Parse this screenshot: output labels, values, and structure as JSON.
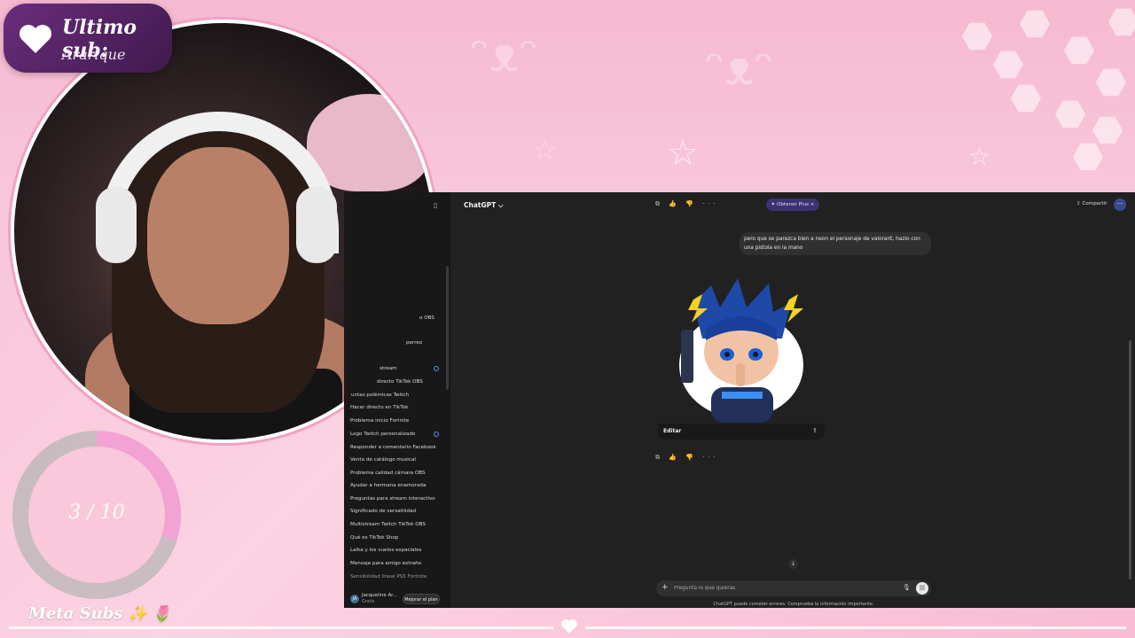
{
  "overlay": {
    "last_sub_title": "Ultimo sub:",
    "last_sub_name": "Ararique",
    "goal_progress_text": "3 / 10",
    "goal_progress_fraction": 0.3,
    "goal_label": "Meta Subs",
    "goal_emoji": "✨ 🌷",
    "colors": {
      "badge": "#5a2670",
      "pink": "#f7c1d6",
      "ring_fill": "#f2a2d3"
    }
  },
  "chatgpt": {
    "title": "ChatGPT ⌵",
    "plus_button": "✦ Obtener Plus ×",
    "share": "⇪ Compartir",
    "more": "···",
    "top_actions": "⧉ 👍 👎 ···",
    "user_message": "pero que se parezca bien a neon el personaje de valorant, hazlo con una pistola en la mano",
    "edit": "Editar",
    "image_actions": "⧉ 👍 👎 ···",
    "composer_placeholder": "Pregunta lo que quieras",
    "disclaimer": "ChatGPT puede cometer errores. Comprueba la información importante.",
    "user_name": "Jacqueline Ar...",
    "user_plan": "Gratis",
    "upgrade": "Mejorar el plan",
    "sidebar_items": [
      "o OBS",
      "perreo",
      "stream",
      "directo TikTok OBS",
      "untas polémicas Twitch",
      "Hacer directo en TikTok",
      "Problema inicio Fortnite",
      "Logo Twitch personalizado",
      "Responder a comentario Facebook",
      "Venta de catálogo musical",
      "Problema calidad cámara OBS",
      "Ayudar a hermana enamorada",
      "Preguntas para stream interactivo",
      "Significado de versatilidad",
      "Multistream Twitch TikTok OBS",
      "Qué es TikTok Shop",
      "Laika y los vuelos espaciales",
      "Mensaje para amigo extraño",
      "Sensibilidad lineal PS5 Fortnite"
    ]
  }
}
